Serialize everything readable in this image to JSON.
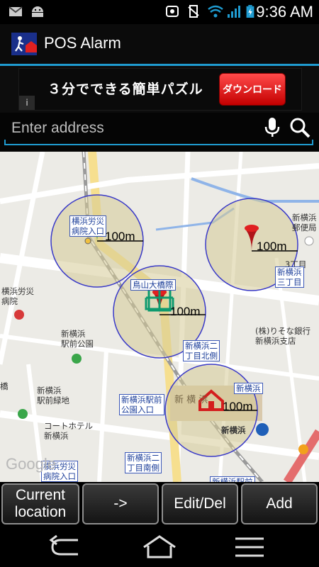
{
  "status_bar": {
    "time": "9:36 AM"
  },
  "app": {
    "title": "POS Alarm"
  },
  "ad": {
    "text": "３分でできる簡単パズル",
    "button_label": "ダウンロード",
    "info": "i"
  },
  "search": {
    "placeholder": "Enter address",
    "value": ""
  },
  "map": {
    "labels": {
      "yokohama_rousai": "横浜労災\n病院",
      "shin_yokohama_ekimae_park": "新横浜\n駅前公園",
      "shin_yokohama_ekimae_green": "新横浜\n駅前緑地",
      "cote_hotel": "コートホテル\n新横浜",
      "risona": "(株)りそな銀行\n新横浜支店",
      "shin_yokohama_post": "新横浜\n郵便局",
      "chome3": "3丁目",
      "shin_yokohama_sta": "新横浜",
      "station_label": "新 横 浜",
      "hashi": "橋",
      "google": "Google"
    },
    "boxes": {
      "rousai_iriguchi_top": "横浜労災\n病院入口",
      "karasuyama_bridge": "鳥山大橋際",
      "shin_yokohama_3chome": "新横浜\n三丁目",
      "shin_yokohama_2chome_north": "新横浜二\n丁目北側",
      "shin_yokohama_ekimae_park_entrance": "新横浜駅前\n公園入口",
      "shin_yokohama_box": "新横浜",
      "shin_yokohama_2chome_south": "新横浜二\n丁目南側",
      "rousai_iriguchi_bottom": "横浜労災\n病院入口",
      "shin_yokohama_ekimae_bottom": "新横浜駅前"
    },
    "alarms": [
      {
        "distance": "100m",
        "marker": "green-pin"
      },
      {
        "distance": "100m",
        "marker": "red-pin"
      },
      {
        "distance": "100m",
        "marker": "red-pin"
      },
      {
        "distance": "100m",
        "marker": "home"
      }
    ]
  },
  "buttons": {
    "current_location": "Current\nlocation",
    "arrow": "->",
    "edit_del": "Edit/Del",
    "add": "Add"
  }
}
